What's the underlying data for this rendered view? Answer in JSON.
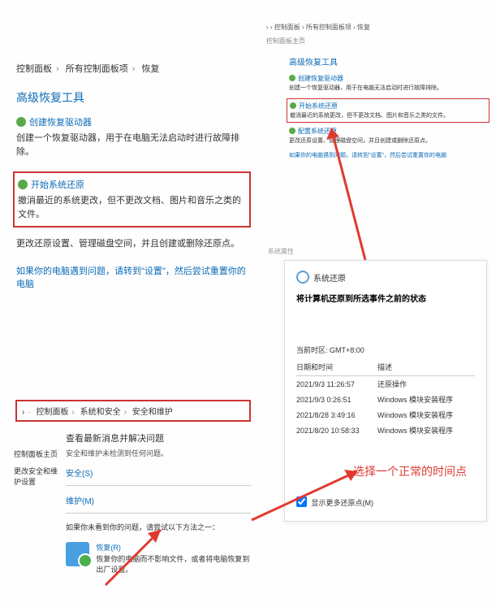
{
  "p1": {
    "crumbs": [
      "控制面板",
      "所有控制面板项",
      "恢复"
    ],
    "title": "高级恢复工具",
    "opt1": {
      "hdr": "创建恢复驱动器",
      "desc": "创建一个恢复驱动器，用于在电脑无法启动时进行故障排除。"
    },
    "opt2": {
      "hdr": "开始系统还原",
      "desc": "撤消最近的系统更改，但不更改文档、图片和音乐之类的文件。"
    },
    "opt3": {
      "hdr": "配置系统还原",
      "desc": "更改还原设置、管理磁盘空间，并且创建或删除还原点。"
    },
    "fine": "如果你的电脑遇到问题，请转到\"设置\"，然后尝试重置你的电脑"
  },
  "p2": {
    "crumbs": "›  ›  控制面板  ›  所有控制面板项  ›  恢复",
    "chip": "控制面板主页",
    "title": "高级恢复工具",
    "opt1": {
      "hdr": "创建恢复驱动器",
      "desc": "创建一个恢复驱动器，用于在电脑无法启动时进行故障排除。"
    },
    "opt2": {
      "hdr": "开始系统还原",
      "desc": "撤消最近的系统更改，但不更改文档、图片和音乐之类的文件。"
    },
    "opt3": {
      "hdr": "配置系统还原",
      "desc": "更改还原设置、管理磁盘空间，并且创建或删除还原点。"
    },
    "fine": "如果你的电脑遇到问题，请转到\"设置\"，然后尝试重置你的电脑"
  },
  "p3": {
    "crumbs": [
      "›",
      "控制面板",
      "系统和安全",
      "安全和维护"
    ],
    "side": [
      "控制面板主页",
      "更改安全和维护设置"
    ],
    "hdr": "查看最新消息并解决问题",
    "sub": "安全和维护未检测到任何问题。",
    "link1": "安全(S)",
    "link2": "维护(M)",
    "note": "如果你未看到你的问题，请尝试以下方法之一：",
    "rec_title": "恢复(R)",
    "rec_desc": "恢复你的电脑而不影响文件，或者将电脑恢复到出厂设置。"
  },
  "p4": {
    "meta": "系统属性",
    "title": "系统还原",
    "head": "将计算机还原到所选事件之前的状态",
    "tz": "当前时区: GMT+8:00",
    "cols": [
      "日期和时间",
      "描述"
    ],
    "rows": [
      [
        "2021/9/3 11:26:57",
        "还原操作"
      ],
      [
        "2021/9/3 0:26:51",
        "Windows 模块安装程序"
      ],
      [
        "2021/8/28 3:49:16",
        "Windows 模块安装程序"
      ],
      [
        "2021/8/20 10:58:33",
        "Windows 模块安装程序"
      ]
    ],
    "chk": "显示更多还原点(M)"
  },
  "annotation": "选择一个正常的时间点"
}
